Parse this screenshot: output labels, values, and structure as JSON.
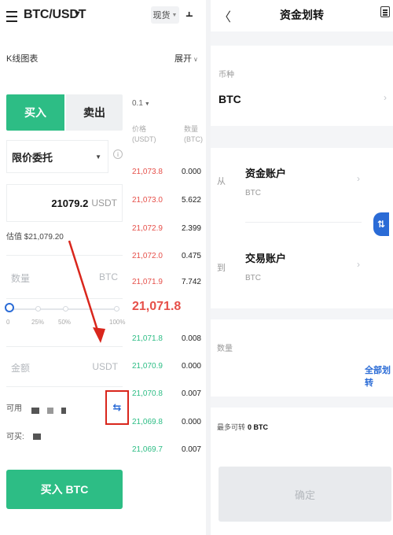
{
  "left": {
    "pair": "BTC/USDT",
    "spot_tag": "现货",
    "kline_label": "K线图表",
    "expand_label": "展开",
    "buy_tab": "买入",
    "sell_tab": "卖出",
    "order_type": "限价委托",
    "price_value": "21079.2",
    "price_unit": "USDT",
    "est_value": "估值 $21,079.20",
    "qty_placeholder": "数量",
    "qty_unit": "BTC",
    "slider_labels": [
      "0",
      "25%",
      "50%",
      "100%"
    ],
    "amount_placeholder": "金额",
    "amount_unit": "USDT",
    "available_label": "可用",
    "can_buy_label": "可买:",
    "buy_button": "买入 BTC"
  },
  "orderbook": {
    "precision": "0.1",
    "price_header": [
      "价格",
      "(USDT)"
    ],
    "qty_header": [
      "数量",
      "(BTC)"
    ],
    "asks": [
      {
        "price": "21,073.8",
        "qty": "0.000"
      },
      {
        "price": "21,073.0",
        "qty": "5.622"
      },
      {
        "price": "21,072.9",
        "qty": "2.399"
      },
      {
        "price": "21,072.0",
        "qty": "0.475"
      },
      {
        "price": "21,071.9",
        "qty": "7.742"
      }
    ],
    "mid_price": "21,071.8",
    "bids": [
      {
        "price": "21,071.8",
        "qty": "0.008"
      },
      {
        "price": "21,070.9",
        "qty": "0.000"
      },
      {
        "price": "21,070.8",
        "qty": "0.007"
      },
      {
        "price": "21,069.8",
        "qty": "0.000"
      },
      {
        "price": "21,069.7",
        "qty": "0.007"
      }
    ]
  },
  "transfer": {
    "title": "资金划转",
    "coin_label": "币种",
    "coin_value": "BTC",
    "from_label": "从",
    "from_account": "资金账户",
    "from_sub": "BTC",
    "to_label": "到",
    "to_account": "交易账户",
    "to_sub": "BTC",
    "qty_label": "数量",
    "all_button": "全部划转",
    "max_label": "最多可转",
    "max_value": "0 BTC",
    "confirm_button": "确定"
  },
  "colors": {
    "buy_green": "#2dbd85",
    "ask_red": "#e6504a",
    "accent_blue": "#2a6bd6",
    "highlight_red": "#d9261c"
  }
}
